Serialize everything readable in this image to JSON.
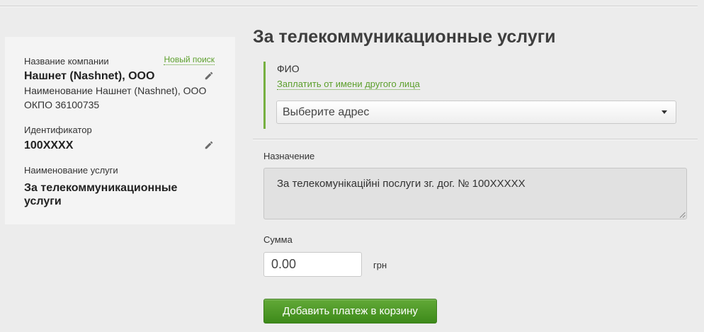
{
  "colors": {
    "page_background": "#ececec",
    "panel_background": "#f4f4f4",
    "link_green": "#5c9f2c",
    "accent_bar_green": "#76b041",
    "button_green_top": "#62a937",
    "button_green_bottom": "#3d8a1a"
  },
  "icons": {
    "edit_company": "pencil-icon",
    "edit_identifier": "pencil-icon",
    "address_dropdown": "caret-down-icon",
    "purpose_resize": "resize-handle-icon"
  },
  "summary_panel": {
    "company_label": "Название компании",
    "new_search_link": "Новый поиск",
    "company_name": "Нашнет (Nashnet), ООО",
    "company_full_name": "Наименование Нашнет (Nashnet), ООО",
    "company_okpo": "ОКПО 36100735",
    "identifier_label": "Идентификатор",
    "identifier_value": "100XXXX",
    "service_label": "Наименование услуги",
    "service_value": "За телекоммуникационные услуги"
  },
  "payment_form": {
    "title": "За телекоммуникационные услуги",
    "payer": {
      "label": "ФИО",
      "pay_for_other_link": "Заплатить от имени другого лица",
      "address_select": {
        "selected": "Выберите адрес"
      }
    },
    "purpose": {
      "label": "Назначение",
      "value": "За телекомунікаційні послуги зг. дог. № 100XXXXX"
    },
    "amount": {
      "label": "Сумма",
      "value": "0.00",
      "currency": "грн"
    },
    "submit_button": "Добавить платеж в корзину"
  }
}
